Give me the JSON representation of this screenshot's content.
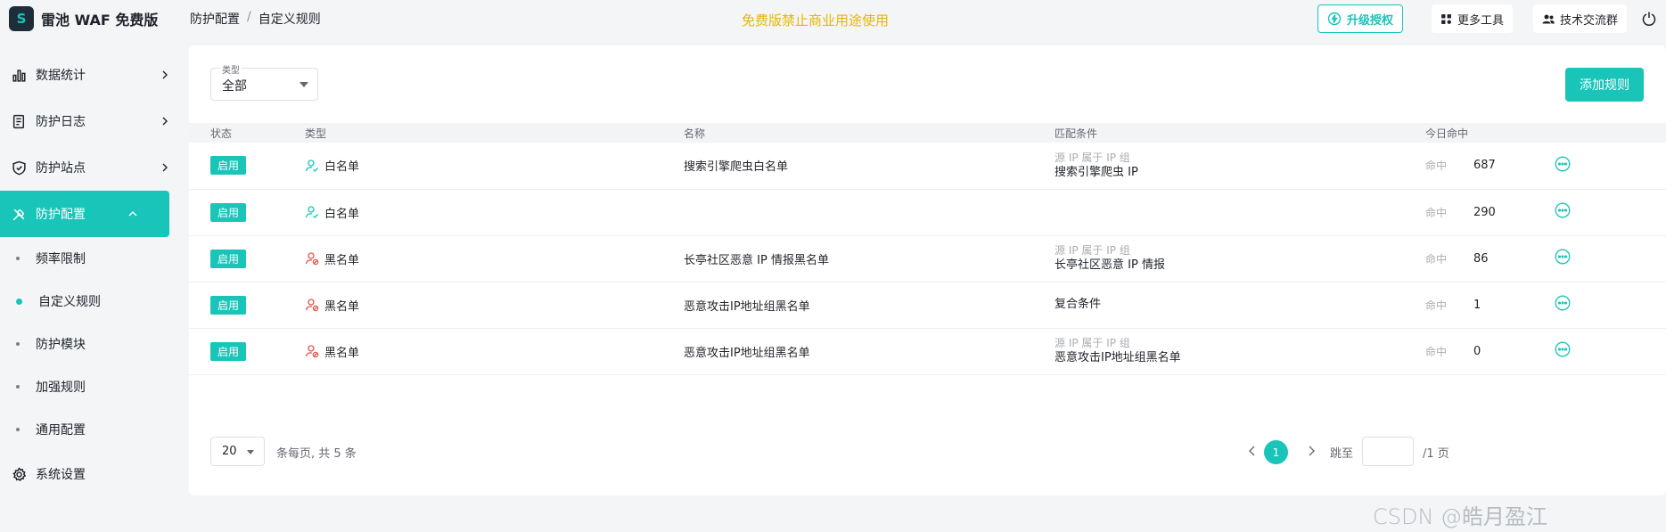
{
  "brand": {
    "name": "雷池 WAF 免费版"
  },
  "header": {
    "breadcrumb": [
      "防护配置",
      "/",
      "自定义规则"
    ],
    "notice": "免费版禁止商业用途使用",
    "upgrade_label": "升级授权",
    "tools_label": "更多工具",
    "group_label": "技术交流群"
  },
  "sidebar": {
    "items": [
      {
        "label": "数据统计"
      },
      {
        "label": "防护日志"
      },
      {
        "label": "防护站点"
      },
      {
        "label": "防护配置"
      }
    ],
    "sub_items": [
      {
        "label": "频率限制"
      },
      {
        "label": "自定义规则"
      },
      {
        "label": "防护模块"
      },
      {
        "label": "加强规则"
      },
      {
        "label": "通用配置"
      }
    ],
    "bottom_item": {
      "label": "系统设置"
    }
  },
  "filter": {
    "label": "类型",
    "value": "全部"
  },
  "add_rule_label": "添加规则",
  "table": {
    "headers": [
      "状态",
      "类型",
      "名称",
      "匹配条件",
      "今日命中"
    ],
    "hit_label": "命中",
    "rows": [
      {
        "status": "启用",
        "type": "白名单",
        "name": "搜索引擎爬虫白名单",
        "cond_label": "源 IP 属于 IP 组",
        "cond_value": "搜索引擎爬虫 IP",
        "hits": "687"
      },
      {
        "status": "启用",
        "type": "白名单",
        "name": "",
        "cond_label": "",
        "cond_value": "",
        "hits": "290"
      },
      {
        "status": "启用",
        "type": "黑名单",
        "name": "长亭社区恶意 IP 情报黑名单",
        "cond_label": "源 IP 属于 IP 组",
        "cond_value": "长亭社区恶意 IP 情报",
        "hits": "86"
      },
      {
        "status": "启用",
        "type": "黑名单",
        "name": "恶意攻击IP地址组黑名单",
        "cond_label": "",
        "cond_value": "复合条件",
        "hits": "1"
      },
      {
        "status": "启用",
        "type": "黑名单",
        "name": "恶意攻击IP地址组黑名单",
        "cond_label": "源 IP 属于 IP 组",
        "cond_value": "恶意攻击IP地址组黑名单",
        "hits": "0"
      }
    ]
  },
  "pagination": {
    "page_size": "20",
    "info": "条每页, 共 5 条",
    "current": "1",
    "jump_label": "跳至",
    "total": "/1 页"
  },
  "watermark": "CSDN @皓月盈江",
  "colors": {
    "accent": "#19c4b8",
    "notice": "#e8b600",
    "blacklist": "#e5534b"
  }
}
